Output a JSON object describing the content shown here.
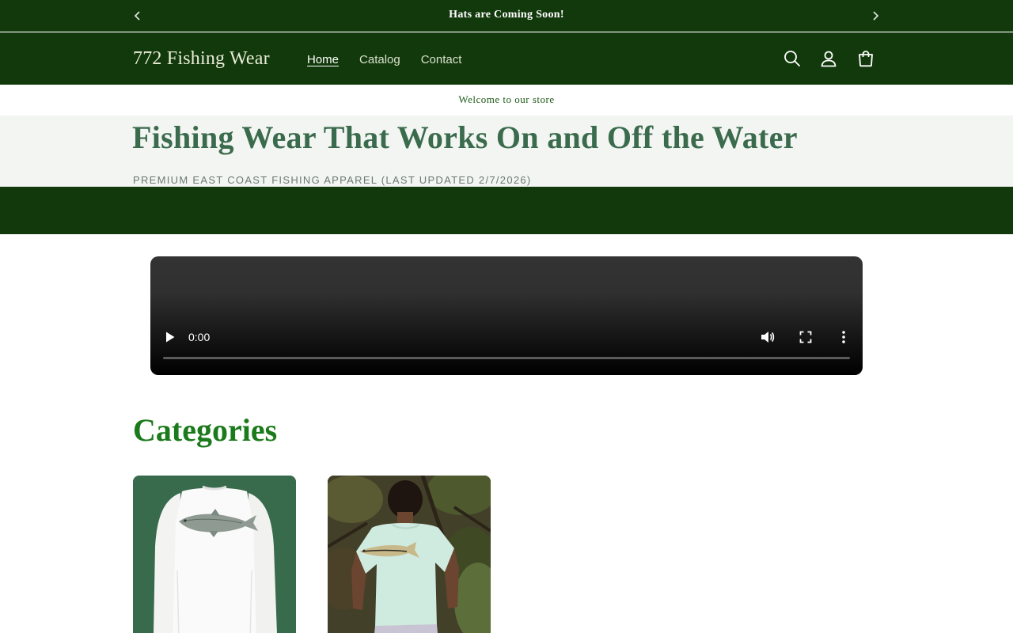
{
  "announcement": {
    "message": "Hats are Coming Soon!",
    "prev_icon": "chevron-left-icon",
    "next_icon": "chevron-right-icon"
  },
  "header": {
    "logo": "772 Fishing Wear",
    "nav": [
      {
        "label": "Home",
        "active": true
      },
      {
        "label": "Catalog",
        "active": false
      },
      {
        "label": "Contact",
        "active": false
      }
    ],
    "icons": [
      "search-icon",
      "account-icon",
      "cart-icon"
    ]
  },
  "welcome": "Welcome to our store",
  "hero": {
    "title": "Fishing Wear That Works On and Off the Water",
    "subtitle": "PREMIUM EAST COAST FISHING APPAREL (LAST UPDATED 2/7/2026)"
  },
  "video": {
    "time": "0:00",
    "progress": 0
  },
  "categories": {
    "heading": "Categories",
    "cards": [
      {
        "image": "white long-sleeve fishing shirt with tarpon graphic"
      },
      {
        "image": "person wearing mint short-sleeve shirt with snook graphic"
      }
    ]
  },
  "colors": {
    "header_bg": "#12390c",
    "hero_title": "#3a6b4d",
    "categories_heading": "#1b7a1b",
    "card1_bg": "#386a4c"
  }
}
